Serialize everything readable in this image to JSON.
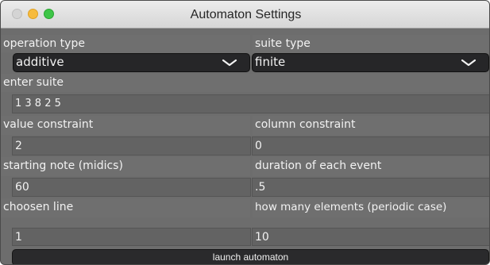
{
  "window": {
    "title": "Automaton Settings"
  },
  "fields": {
    "operation_type": {
      "label": "operation type",
      "value": "additive"
    },
    "suite_type": {
      "label": "suite type",
      "value": "finite"
    },
    "enter_suite": {
      "label": "enter suite",
      "value": "1 3 8 2 5"
    },
    "value_constraint": {
      "label": "value constraint",
      "value": "2"
    },
    "column_constraint": {
      "label": "column constraint",
      "value": "0"
    },
    "starting_note": {
      "label": "starting note (midics)",
      "value": "60"
    },
    "duration": {
      "label": "duration of each event",
      "value": ".5"
    },
    "choosen_line": {
      "label": "choosen line",
      "value": "1"
    },
    "elements_count": {
      "label": "how many elements (periodic case)",
      "value": "10"
    }
  },
  "actions": {
    "launch_label": "launch automaton"
  }
}
